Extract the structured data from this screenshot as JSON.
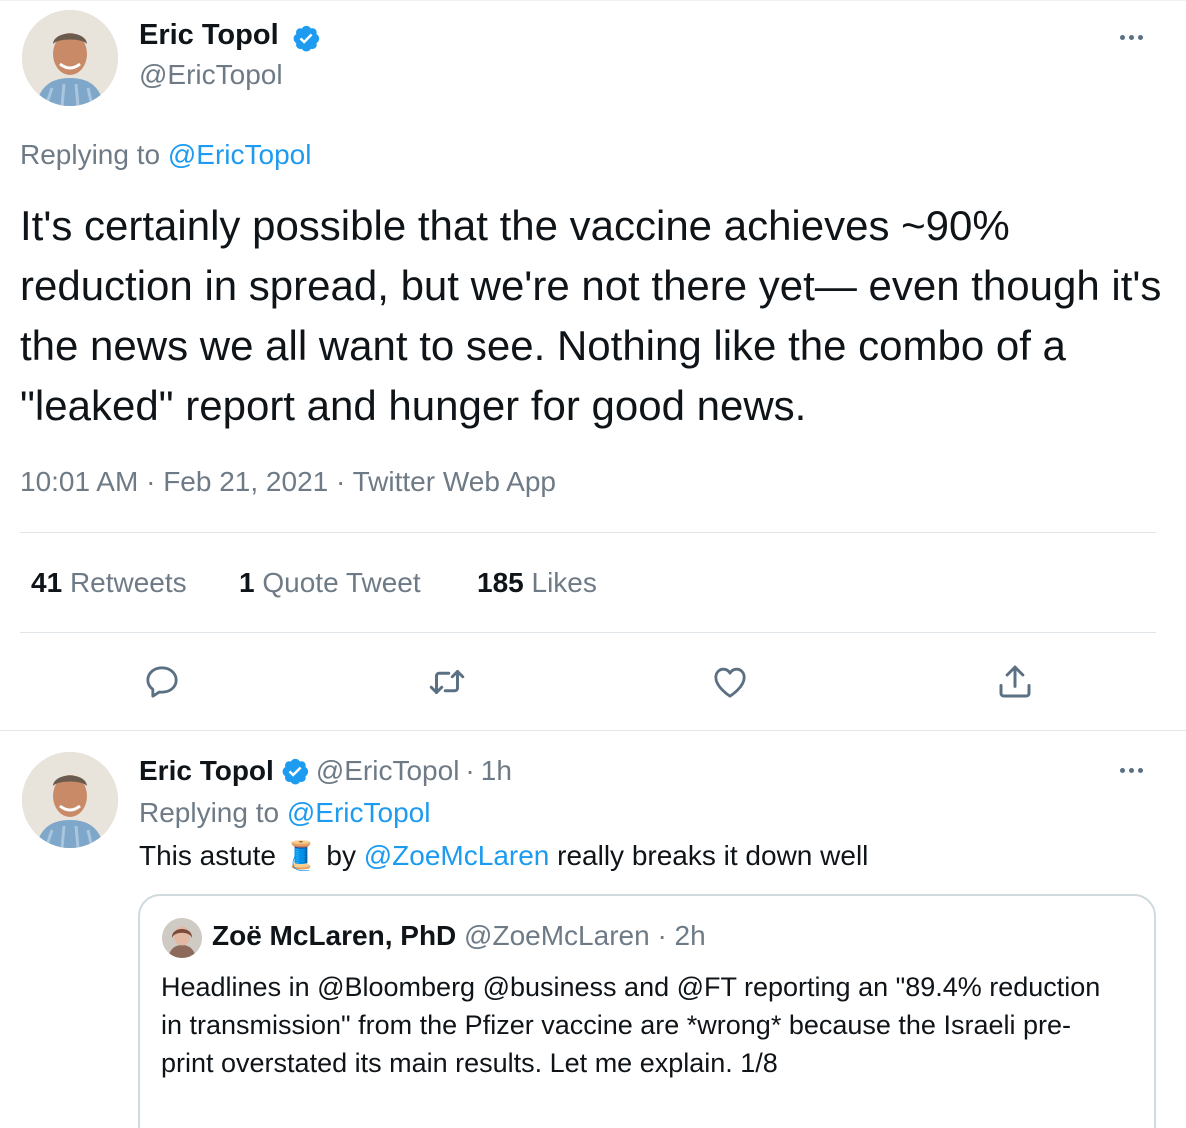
{
  "main_tweet": {
    "author_name": "Eric Topol",
    "author_handle": "@EricTopol",
    "replying_label": "Replying to",
    "replying_handle": "@EricTopol",
    "text": "It's certainly possible that the vaccine achieves ~90% reduction in spread, but we're not there yet— even though it's the news we all want to see. Nothing like the combo of a \"leaked\" report and hunger for good news.",
    "time": "10:01 AM",
    "date": "Feb 21, 2021",
    "source": "Twitter Web App",
    "sep": "·",
    "stats": {
      "retweets_count": "41",
      "retweets_label": "Retweets",
      "quotes_count": "1",
      "quotes_label": "Quote Tweet",
      "likes_count": "185",
      "likes_label": "Likes"
    },
    "actions": [
      "reply-icon",
      "retweet-icon",
      "like-icon",
      "share-icon"
    ]
  },
  "reply_tweet": {
    "author_name": "Eric Topol",
    "author_handle": "@EricTopol",
    "sep": "·",
    "age": "1h",
    "replying_label": "Replying to",
    "replying_handle": "@EricTopol",
    "text_before": "This astute",
    "emoji_thread": "🧵",
    "text_by": "by",
    "mention": "@ZoeMcLaren",
    "text_after": "really breaks it down well"
  },
  "quoted_tweet": {
    "author_name": "Zoë McLaren, PhD",
    "author_handle": "@ZoeMcLaren",
    "sep": "·",
    "age": "2h",
    "text": "Headlines in @Bloomberg @business and @FT reporting an \"89.4% reduction in transmission\" from the Pfizer vaccine are *wrong* because the Israeli pre-print overstated its main results. Let me explain. 1/8"
  },
  "colors": {
    "accent": "#1d9bf0",
    "muted_text": "#6e7b86",
    "divider": "#e1e6ea",
    "verified": "#1d9bf0"
  }
}
